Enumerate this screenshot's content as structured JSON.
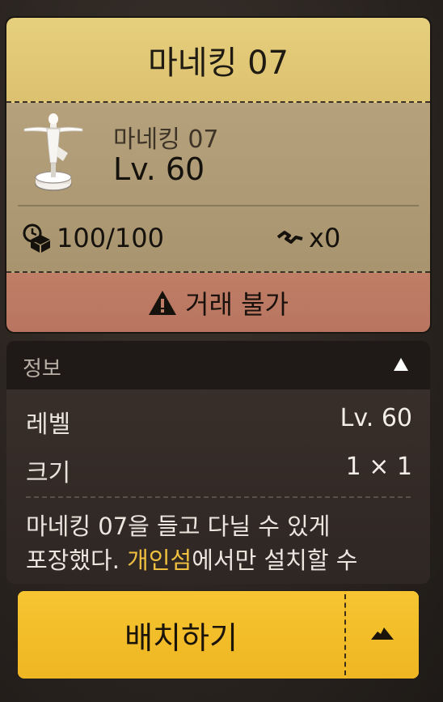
{
  "card": {
    "title": "마네킹 07",
    "item_name": "마네킹 07",
    "level": "Lv. 60",
    "durability": "100/100",
    "count": "x0",
    "trade_status": "거래 불가"
  },
  "info": {
    "header": "정보",
    "rows": [
      {
        "label": "레벨",
        "value": "Lv. 60"
      },
      {
        "label": "크기",
        "value": "1 × 1"
      }
    ],
    "desc_line1": "마네킹 07을 들고 다닐 수 있게",
    "desc_line2_pre": "포장했다. ",
    "desc_line2_highlight": "개인섬",
    "desc_line2_post": "에서만 설치할 수"
  },
  "actions": {
    "place_label": "배치하기"
  },
  "colors": {
    "title_bg": "#e6cf7d",
    "body_bg": "#b5a17b",
    "trade_bg": "#c07e66",
    "button_bg": "#f3bd28",
    "highlight": "#f0c040"
  },
  "icons": {
    "item": "mannequin-icon",
    "durability": "durability-box-icon",
    "count": "handshake-icon",
    "trade": "warning-icon",
    "collapse": "triangle-up-icon",
    "menu": "mound-icon"
  }
}
